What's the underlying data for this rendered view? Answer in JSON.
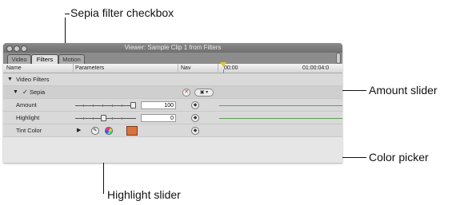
{
  "callouts": {
    "sepia_checkbox": "Sepia filter checkbox",
    "amount_slider": "Amount slider",
    "color_picker": "Color picker",
    "highlight_slider": "Highlight slider"
  },
  "window": {
    "title": "Viewer: Sample Clip 1 from Filters",
    "tabs": [
      "Video",
      "Filters",
      "Motion"
    ],
    "active_tab": "Filters"
  },
  "columns": {
    "name": "Name",
    "parameters": "Parameters",
    "nav": "Nav",
    "timecode_start": "00:00",
    "timecode_end": "01:00:04:0"
  },
  "rows": {
    "video_filters": "Video Filters",
    "sepia": "Sepia",
    "amount": {
      "label": "Amount",
      "value": "100"
    },
    "highlight": {
      "label": "Highlight",
      "value": "0"
    },
    "tint_color": {
      "label": "Tint Color",
      "swatch": "#d9733e"
    }
  },
  "colors": {
    "keyframe_line": "#5aa14f",
    "playhead": "#e3c22a",
    "reset_button": "#c23b3b"
  }
}
